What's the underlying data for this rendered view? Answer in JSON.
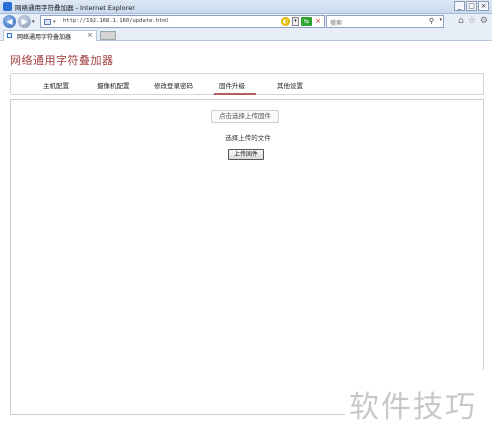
{
  "window": {
    "title": "网络通用字符叠加器 - Internet Explorer",
    "buttons": [
      "_",
      "□",
      "×"
    ]
  },
  "address_bar": {
    "url": "http://192.168.1.160/update.html",
    "compat_label": "▾"
  },
  "search": {
    "placeholder": "搜索",
    "icon": "search-icon"
  },
  "tab": {
    "label": "网络通用字符叠加器",
    "close": "×"
  },
  "page": {
    "title": "网络通用字符叠加器"
  },
  "menu": {
    "items": [
      "主机配置",
      "摄像机配置",
      "修改登录密码",
      "固件升级",
      "其他设置"
    ],
    "active_index": 3
  },
  "firmware": {
    "pick_button": "点击选择上传固件",
    "file_label": "选择上传的文件",
    "upload_button": "上传固件"
  },
  "watermark": "软件技巧",
  "colors": {
    "title": "#a23c3c",
    "active_underline": "#b85a5a"
  }
}
